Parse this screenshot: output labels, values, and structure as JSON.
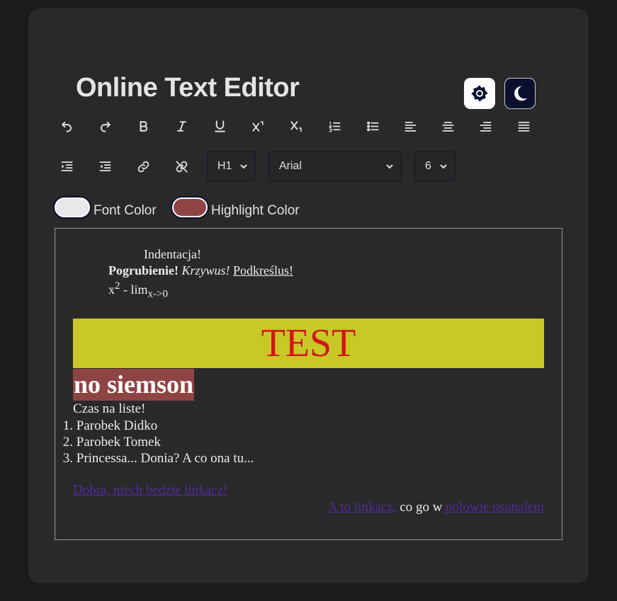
{
  "header": {
    "title": "Online Text Editor",
    "theme_buttons": [
      {
        "name": "light-theme",
        "icon": "sun-gear-icon"
      },
      {
        "name": "dark-theme",
        "icon": "moon-icon"
      }
    ]
  },
  "toolbar": {
    "row1": [
      "undo-icon",
      "redo-icon",
      "bold-icon",
      "italic-icon",
      "underline-icon",
      "superscript-icon",
      "subscript-icon",
      "ordered-list-icon",
      "unordered-list-icon",
      "align-left-icon",
      "align-center-icon",
      "align-right-icon",
      "justify-icon"
    ],
    "row2": [
      "indent-icon",
      "outdent-icon",
      "link-icon",
      "unlink-icon"
    ],
    "heading_select": "H1",
    "font_select": "Arial",
    "size_select": "6",
    "font_color_label": "Font Color",
    "highlight_color_label": "Highlight Color",
    "font_color": "#e8e8e8",
    "highlight_color": "#8f4444"
  },
  "editor": {
    "indent_text": "Indentacja!",
    "bold_text": "Pogrubienie!",
    "italic_text": "Krzywus!",
    "underline_text": "Podkreślus!",
    "math_base": "x",
    "math_sup": "2",
    "math_mid": " - lim",
    "math_sub": "x->0",
    "banner_text": "TEST",
    "highlight_heading": "no siemson",
    "list_intro": "Czas na liste!",
    "list_items": [
      "Parobek Didko",
      "Parobek Tomek",
      "Princessa... Donia? A co ona tu..."
    ],
    "link1": "Dobra, niech bedzie linkacz!",
    "link2": "A to linkacz,",
    "plain_mid": " co go w",
    "link3": " polowie usunalem"
  },
  "colors": {
    "banner_bg": "#c8c827",
    "banner_text": "#d3141a",
    "link": "#4f2c9e"
  }
}
